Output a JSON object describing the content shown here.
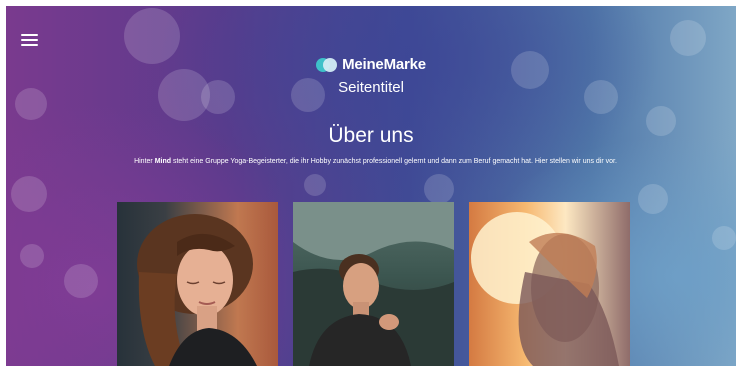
{
  "header": {
    "menu_icon": "hamburger-menu-icon",
    "brand_name": "MeineMarke",
    "logo_icon": "overlapping-circles-logo-icon",
    "site_title": "Seitentitel"
  },
  "about": {
    "heading": "Über uns",
    "intro_before": "Hinter ",
    "intro_bold": "Mind",
    "intro_after": " steht eine Gruppe Yoga-Begeisterter, die ihr Hobby zunächst professionell gelernt und dann zum Beruf gemacht hat. Hier stellen wir uns dir vor."
  },
  "team": [
    {
      "photo": "woman-eyes-closed-photo"
    },
    {
      "photo": "man-mountains-photo"
    },
    {
      "photo": "woman-sunset-photo"
    }
  ],
  "colors": {
    "logo_teal": "#3ec1c9",
    "logo_light": "#d2ecf4",
    "text": "#ffffff"
  }
}
